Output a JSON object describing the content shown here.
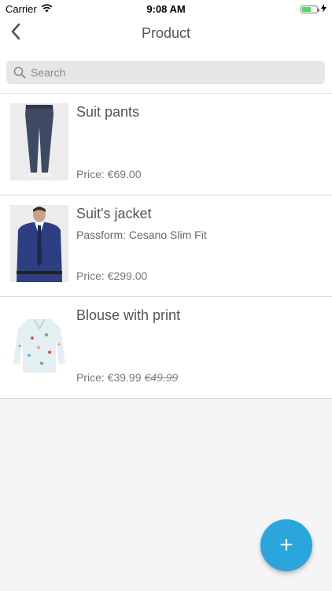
{
  "status_bar": {
    "carrier": "Carrier",
    "time": "9:08 AM",
    "battery_level": 0.6,
    "battery_color": "#4cd964"
  },
  "nav": {
    "title": "Product",
    "back_icon": "chevron-left-icon"
  },
  "search": {
    "placeholder": "Search",
    "value": "",
    "icon": "search-icon"
  },
  "products": [
    {
      "title": "Suit pants",
      "subtitle": "",
      "price": "Price: €69.00",
      "old_price": "",
      "image": "suit-pants-image"
    },
    {
      "title": "Suit's jacket",
      "subtitle": "Passform: Cesano Slim Fit",
      "price": "Price: €299.00",
      "old_price": "",
      "image": "suit-jacket-image"
    },
    {
      "title": "Blouse with print",
      "subtitle": "",
      "price": "Price: €39.99",
      "old_price": "€49.99",
      "image": "blouse-image"
    }
  ],
  "fab": {
    "label": "+",
    "color": "#2ba6dc"
  }
}
